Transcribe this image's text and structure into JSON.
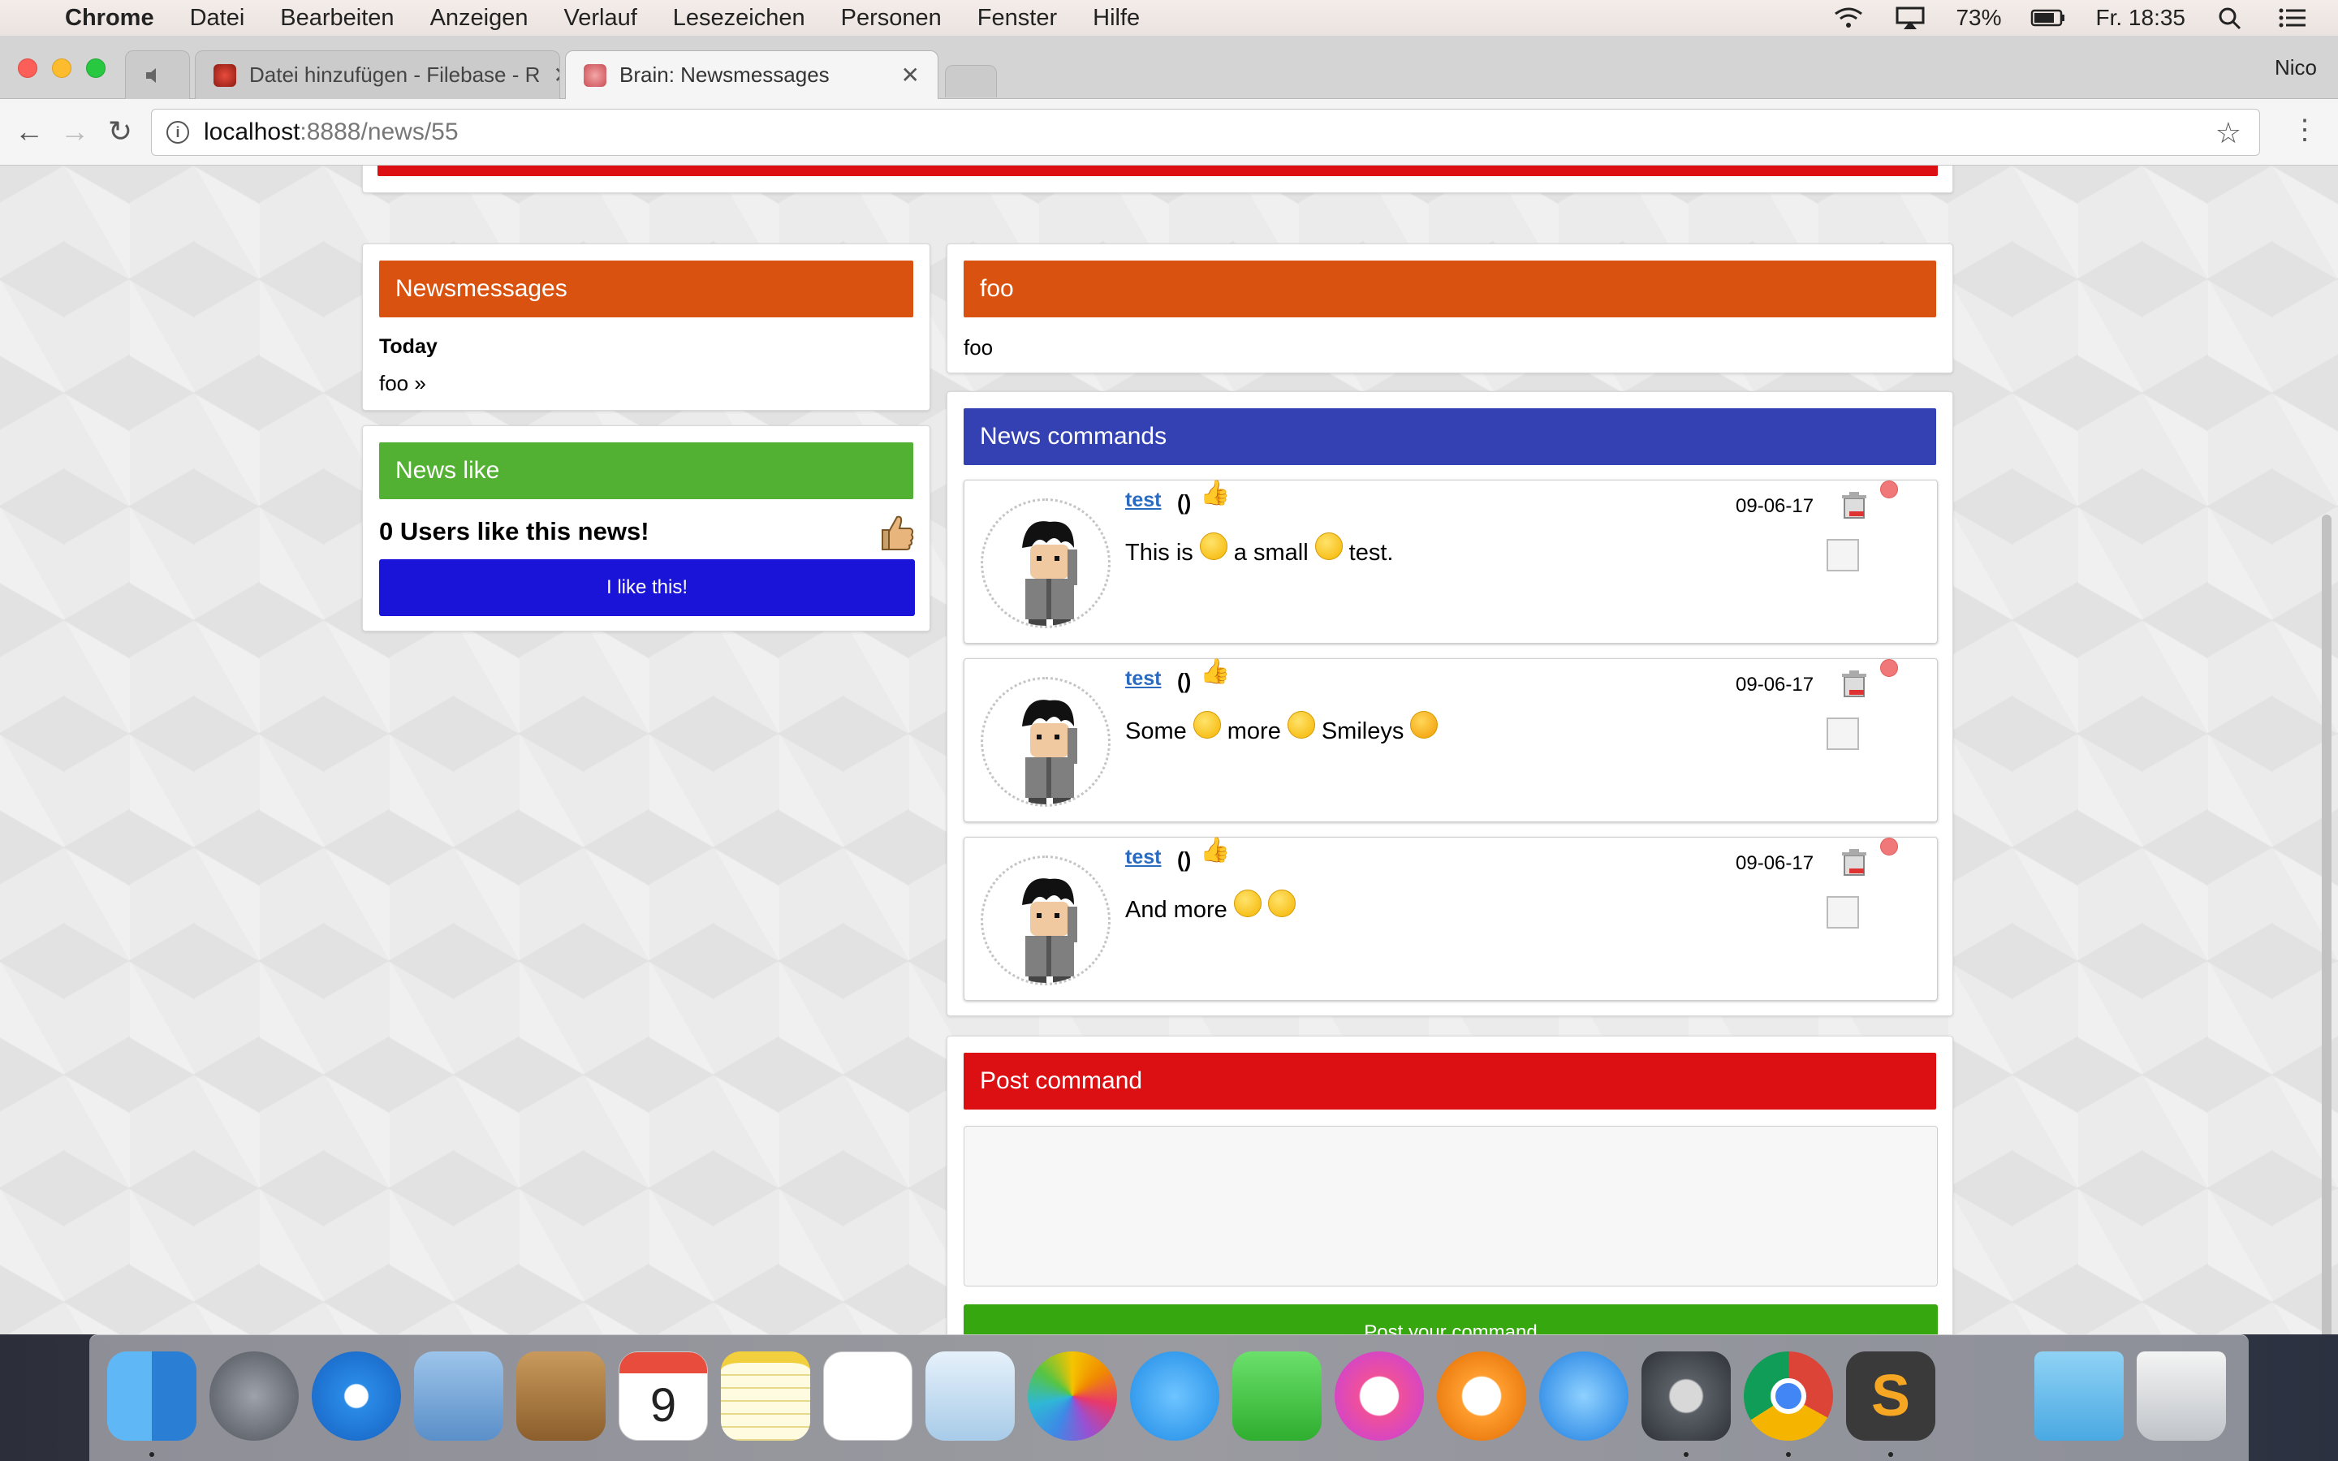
{
  "menubar": {
    "app": "Chrome",
    "items": [
      "Datei",
      "Bearbeiten",
      "Anzeigen",
      "Verlauf",
      "Lesezeichen",
      "Personen",
      "Fenster",
      "Hilfe"
    ],
    "battery": "73%",
    "clock": "Fr. 18:35"
  },
  "browser": {
    "tabs": [
      {
        "label": "Datei hinzufügen - Filebase - R"
      },
      {
        "label": "Brain: Newsmessages"
      }
    ],
    "profile": "Nico",
    "url_host": "localhost",
    "url_path": ":8888/news/55",
    "info_icon": "i"
  },
  "sidebar": {
    "newsmessages": {
      "title": "Newsmessages",
      "group_label": "Today",
      "item": "foo »"
    },
    "newslike": {
      "title": "News like",
      "count_text": "0 Users like this news!",
      "button": "I like this!"
    }
  },
  "article": {
    "title": "foo",
    "body": "foo"
  },
  "commands": {
    "title": "News commands",
    "items": [
      {
        "author": "test",
        "paren": "()",
        "date": "09-06-17",
        "segments": [
          "This is",
          "a small",
          "test."
        ]
      },
      {
        "author": "test",
        "paren": "()",
        "date": "09-06-17",
        "segments": [
          "Some",
          "more",
          "Smileys",
          ""
        ]
      },
      {
        "author": "test",
        "paren": "()",
        "date": "09-06-17",
        "segments": [
          "And more",
          "",
          ""
        ]
      }
    ]
  },
  "post": {
    "title": "Post command",
    "button": "Post your command"
  },
  "colors": {
    "red": "#dc0f12",
    "orange": "#d9520f",
    "green": "#52b132",
    "blue_header": "#3441b2",
    "like_button": "#1a14d9",
    "post_button": "#36a70e"
  }
}
